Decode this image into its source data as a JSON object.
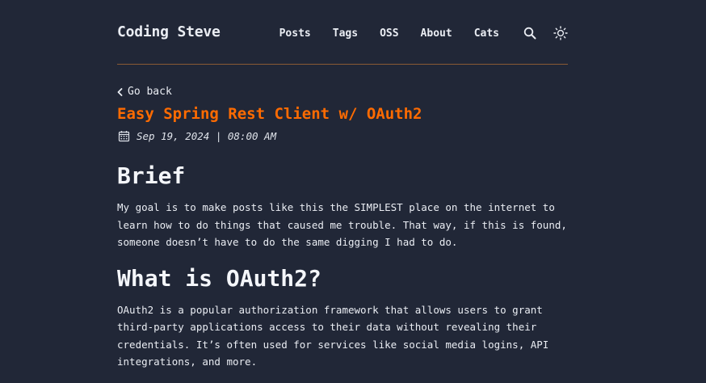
{
  "header": {
    "brand": "Coding Steve",
    "nav": [
      "Posts",
      "Tags",
      "OSS",
      "About",
      "Cats"
    ],
    "icons": [
      "search-icon",
      "sun-icon"
    ]
  },
  "back_link": "Go back",
  "post": {
    "title": "Easy Spring Rest Client w/ OAuth2",
    "date": "Sep 19, 2024 | 08:00 AM"
  },
  "sections": [
    {
      "heading": "Brief",
      "body": "My goal is to make posts like this the SIMPLEST place on the internet to learn how to do things that caused me trouble. That way, if this is found, someone doesn’t have to do the same digging I had to do."
    },
    {
      "heading": "What is OAuth2?",
      "body": "OAuth2 is a popular authorization framework that allows users to grant third-party applications access to their data without revealing their credentials. It’s often used for services like social media logins, API integrations, and more."
    }
  ],
  "colors": {
    "background": "#212737",
    "accent": "#ff6b01",
    "text": "#eaedf3",
    "divider": "#8a5a34"
  }
}
